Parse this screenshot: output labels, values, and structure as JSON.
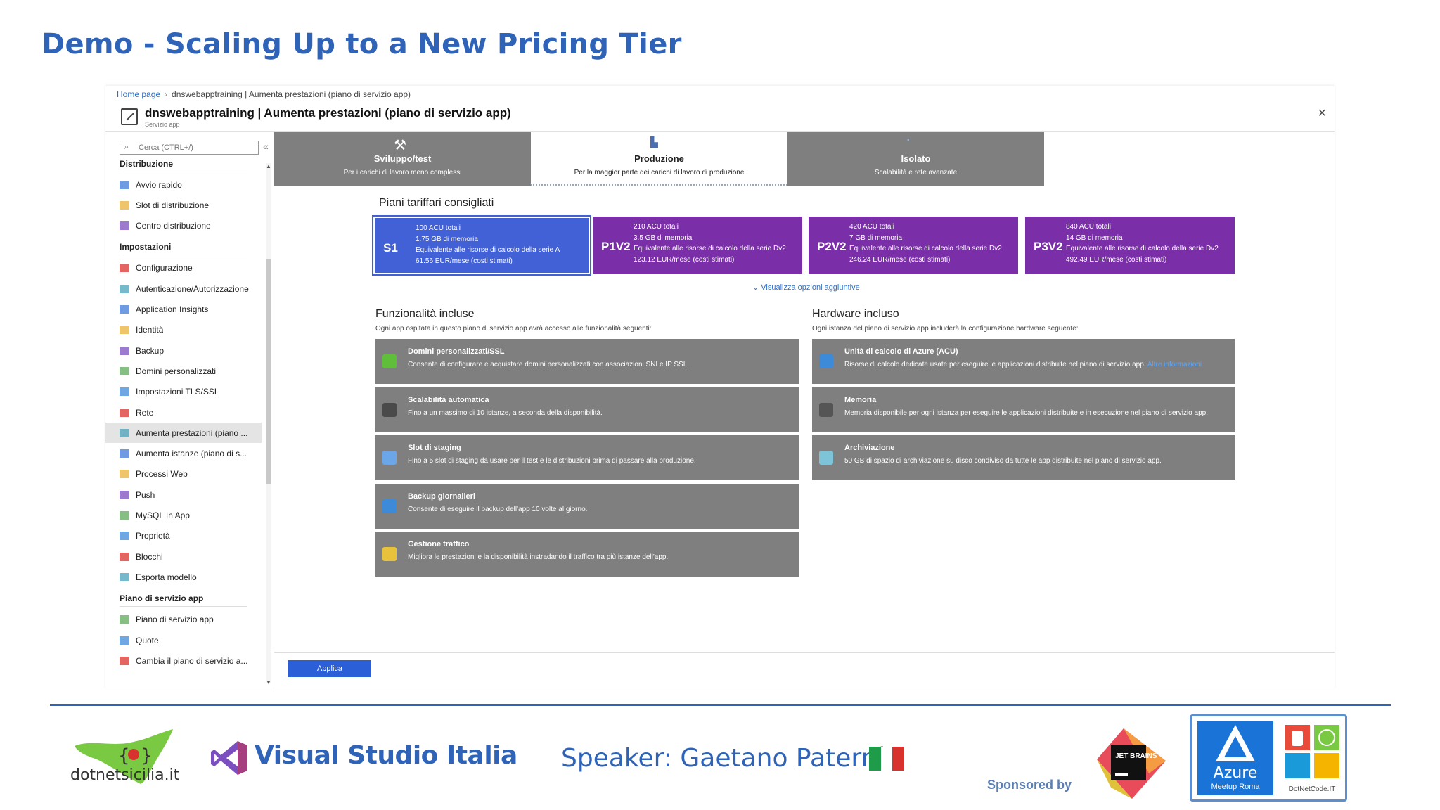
{
  "slide": {
    "title": "Demo - Scaling Up to a New Pricing Tier"
  },
  "portal": {
    "breadcrumb": {
      "home": "Home page",
      "current": "dnswebapptraining | Aumenta prestazioni (piano di servizio app)"
    },
    "blade": {
      "title": "dnswebapptraining | Aumenta prestazioni (piano di servizio app)",
      "subtitle": "Servizio app",
      "close": "×"
    },
    "search": {
      "placeholder": "Cerca (CTRL+/)"
    },
    "sidebar": {
      "collapse": "«",
      "sections": [
        {
          "title": "Distribuzione",
          "items": [
            "Avvio rapido",
            "Slot di distribuzione",
            "Centro distribuzione"
          ]
        },
        {
          "title": "Impostazioni",
          "items": [
            "Configurazione",
            "Autenticazione/Autorizzazione",
            "Application Insights",
            "Identità",
            "Backup",
            "Domini personalizzati",
            "Impostazioni TLS/SSL",
            "Rete",
            "Aumenta prestazioni (piano ...",
            "Aumenta istanze (piano di s...",
            "Processi Web",
            "Push",
            "MySQL In App",
            "Proprietà",
            "Blocchi",
            "Esporta modello"
          ]
        },
        {
          "title": "Piano di servizio app",
          "items": [
            "Piano di servizio app",
            "Quote",
            "Cambia il piano di servizio a..."
          ]
        }
      ],
      "active_item": "Aumenta prestazioni (piano ..."
    },
    "tabs": [
      {
        "name": "Sviluppo/test",
        "desc": "Per i carichi di lavoro meno complessi",
        "icon": "tools-icon"
      },
      {
        "name": "Produzione",
        "desc": "Per la maggior parte dei carichi di lavoro di produzione",
        "icon": "building-icon"
      },
      {
        "name": "Isolato",
        "desc": "Scalabilità e rete avanzate",
        "icon": "isolated-icon"
      }
    ],
    "recommended": {
      "title": "Piani tariffari consigliati",
      "plans": [
        {
          "code": "S1",
          "lines": [
            "100 ACU totali",
            "1.75 GB di memoria",
            "Equivalente alle risorse di calcolo della serie A",
            "61.56 EUR/mese (costi stimati)"
          ]
        },
        {
          "code": "P1V2",
          "lines": [
            "210 ACU totali",
            "3.5 GB di memoria",
            "Equivalente alle risorse di calcolo della serie Dv2",
            "123.12 EUR/mese (costi stimati)"
          ]
        },
        {
          "code": "P2V2",
          "lines": [
            "420 ACU totali",
            "7 GB di memoria",
            "Equivalente alle risorse di calcolo della serie Dv2",
            "246.24 EUR/mese (costi stimati)"
          ]
        },
        {
          "code": "P3V2",
          "lines": [
            "840 ACU totali",
            "14 GB di memoria",
            "Equivalente alle risorse di calcolo della serie Dv2",
            "492.49 EUR/mese (costi stimati)"
          ]
        }
      ],
      "more": "Visualizza opzioni aggiuntive"
    },
    "features": {
      "title": "Funzionalità incluse",
      "desc": "Ogni app ospitata in questo piano di servizio app avrà accesso alle funzionalità seguenti:",
      "items": [
        {
          "title": "Domini personalizzati/SSL",
          "desc": "Consente di configurare e acquistare domini personalizzati con associazioni SNI e IP SSL",
          "color": "#5fbf3a"
        },
        {
          "title": "Scalabilità automatica",
          "desc": "Fino a un massimo di 10 istanze, a seconda della disponibilità.",
          "color": "#4a4a4a"
        },
        {
          "title": "Slot di staging",
          "desc": "Fino a 5 slot di staging da usare per il test e le distribuzioni prima di passare alla produzione.",
          "color": "#6aa6e8"
        },
        {
          "title": "Backup giornalieri",
          "desc": "Consente di eseguire il backup dell'app 10 volte al giorno.",
          "color": "#3d8ad8"
        },
        {
          "title": "Gestione traffico",
          "desc": "Migliora le prestazioni e la disponibilità instradando il traffico tra più istanze dell'app.",
          "color": "#e8c23a"
        }
      ]
    },
    "hardware": {
      "title": "Hardware incluso",
      "desc": "Ogni istanza del piano di servizio app includerà la configurazione hardware seguente:",
      "items": [
        {
          "title": "Unità di calcolo di Azure (ACU)",
          "desc": "Risorse di calcolo dedicate usate per eseguire le applicazioni distribuite nel piano di servizio app.",
          "link": "Altre informazioni",
          "color": "#3d8ad8"
        },
        {
          "title": "Memoria",
          "desc": "Memoria disponibile per ogni istanza per eseguire le applicazioni distribuite e in esecuzione nel piano di servizio app.",
          "link": "",
          "color": "#555555"
        },
        {
          "title": "Archiviazione",
          "desc": "50 GB di spazio di archiviazione su disco condiviso da tutte le app distribuite nel piano di servizio app.",
          "link": "",
          "color": "#7ec4d8"
        }
      ]
    },
    "apply": "Applica"
  },
  "footer": {
    "dotnetsicilia": "dotnetsicilia.it",
    "vs": "Visual Studio Italia",
    "speaker": "Speaker: Gaetano Paternò",
    "sponsored": "Sponsored by",
    "jetbrains": "JET BRAINS",
    "azure": "Azure",
    "azure_sub": "Meetup Roma",
    "dotnetcode": "DotNetCode.IT"
  }
}
